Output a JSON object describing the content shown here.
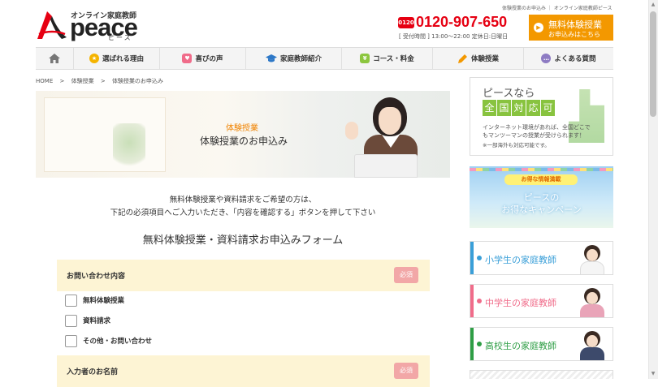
{
  "header": {
    "logo_tagline": "オンライン家庭教師",
    "logo_word": "peace",
    "logo_kana": "ピース",
    "top_links": "体験授業のお申込み ｜ オンライン家庭教師ピース",
    "tel_icon": "0120",
    "tel_number": "0120-907-650",
    "tel_hours": "[ 受付時間 ] 13:00～22:00 定休日:日曜日",
    "trial_button": {
      "line1": "無料体験授業",
      "line2": "お申込みはこちら"
    }
  },
  "nav": [
    {
      "label": "",
      "icon": "home-icon",
      "color": "#777777"
    },
    {
      "label": "選ばれる理由",
      "icon": "medal-icon",
      "color": "#f5b400"
    },
    {
      "label": "喜びの声",
      "icon": "heart-icon",
      "color": "#f06c8a"
    },
    {
      "label": "家庭教師紹介",
      "icon": "graduation-cap-icon",
      "color": "#2e78c7"
    },
    {
      "label": "コース・料金",
      "icon": "yen-icon",
      "color": "#8cc63f"
    },
    {
      "label": "体験授業",
      "icon": "pencil-icon",
      "color": "#f39800"
    },
    {
      "label": "よくある質問",
      "icon": "chat-icon",
      "color": "#8e7cc3"
    }
  ],
  "breadcrumb": [
    "HOME",
    ">",
    "体験授業",
    ">",
    "体験授業のお申込み"
  ],
  "hero": {
    "category": "体験授業",
    "title": "体験授業のお申込み"
  },
  "intro": {
    "line1": "無料体験授業や資料請求をご希望の方は、",
    "line2": "下記の必須項目へご入力いただき、「内容を確認する」ボタンを押して下さい"
  },
  "form": {
    "title": "無料体験授業・資料請求お申込みフォーム",
    "sections": [
      {
        "title": "お問い合わせ内容",
        "required": "必須"
      },
      {
        "title": "入力者のお名前",
        "required": "必須"
      }
    ],
    "options": [
      "無料体験授業",
      "資料請求",
      "その他・お問い合わせ"
    ]
  },
  "sidebar": {
    "nationwide": {
      "line1": "ピースなら",
      "line2_chars": [
        "全",
        "国",
        "対",
        "応",
        "可"
      ],
      "desc1": "インターネット環境があれば、全国どこで",
      "desc2": "もマンツーマンの授業が受けられます！",
      "desc3": "※一部海外も対応可能です。"
    },
    "campaign": {
      "tag": "お得な情報満載",
      "line1": "ピースの",
      "line2": "お得なキャンペーン"
    },
    "tutors": [
      {
        "label": "小学生の家庭教師",
        "color": "#3a9fd8",
        "uniform": "#ffffff"
      },
      {
        "label": "中学生の家庭教師",
        "color": "#f06c8a",
        "uniform": "#e9a4b8"
      },
      {
        "label": "高校生の家庭教師",
        "color": "#2e9e45",
        "uniform": "#3d4a6b"
      }
    ]
  },
  "colors": {
    "accent": "#f39800",
    "tel": "#e60012",
    "section_bg": "#fdf4d4",
    "required": "#f2a7a7"
  }
}
